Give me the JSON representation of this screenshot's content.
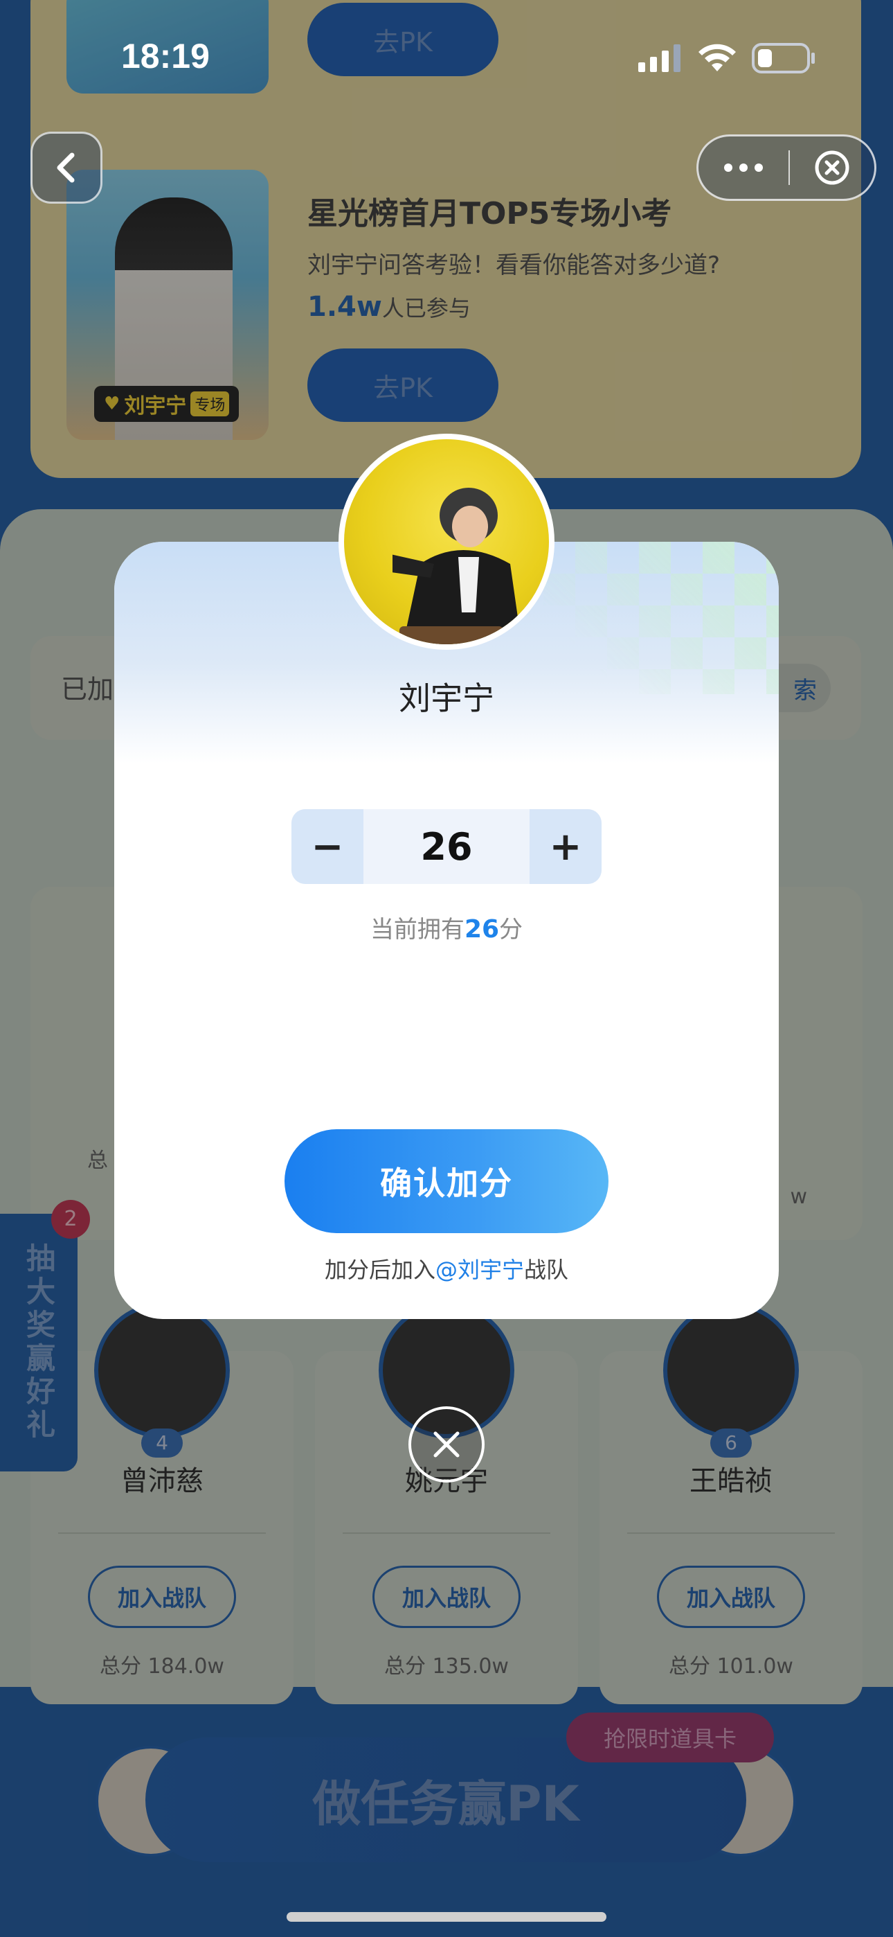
{
  "status": {
    "time": "18:19"
  },
  "background": {
    "card_top": {
      "button_label": "去PK"
    },
    "card_second": {
      "title": "星光榜首月TOP5专场小考",
      "desc": "刘宇宁问答考验！看看你能答对多少道?",
      "participants_num": "1.4w",
      "participants_label": "人已参与",
      "button_label": "去PK",
      "tag_name": "刘宇宁",
      "tag_sub": "专场"
    },
    "search": {
      "label": "已加",
      "button": "索"
    },
    "side": {
      "label": "抽大奖赢好礼",
      "badge": "2"
    },
    "rank_cards": [
      {
        "rank": "4",
        "name": "曾沛慈",
        "join": "加入战队",
        "total": "总分 184.0w"
      },
      {
        "rank": "",
        "name": "姚元宇",
        "join": "加入战队",
        "total": "总分 135.0w"
      },
      {
        "rank": "6",
        "name": "王皓祯",
        "join": "加入战队",
        "total": "总分 101.0w"
      }
    ],
    "partial_left": "总",
    "partial_right": "w",
    "task": {
      "label": "做任务赢PK",
      "tip": "抢限时道具卡"
    }
  },
  "modal": {
    "name": "刘宇宁",
    "value": "26",
    "minus": "−",
    "plus": "+",
    "owned_prefix": "当前拥有",
    "owned_value": "26",
    "owned_suffix": "分",
    "confirm": "确认加分",
    "note_prefix": "加分后加入",
    "note_at": "@刘宇宁",
    "note_suffix": "战队"
  }
}
